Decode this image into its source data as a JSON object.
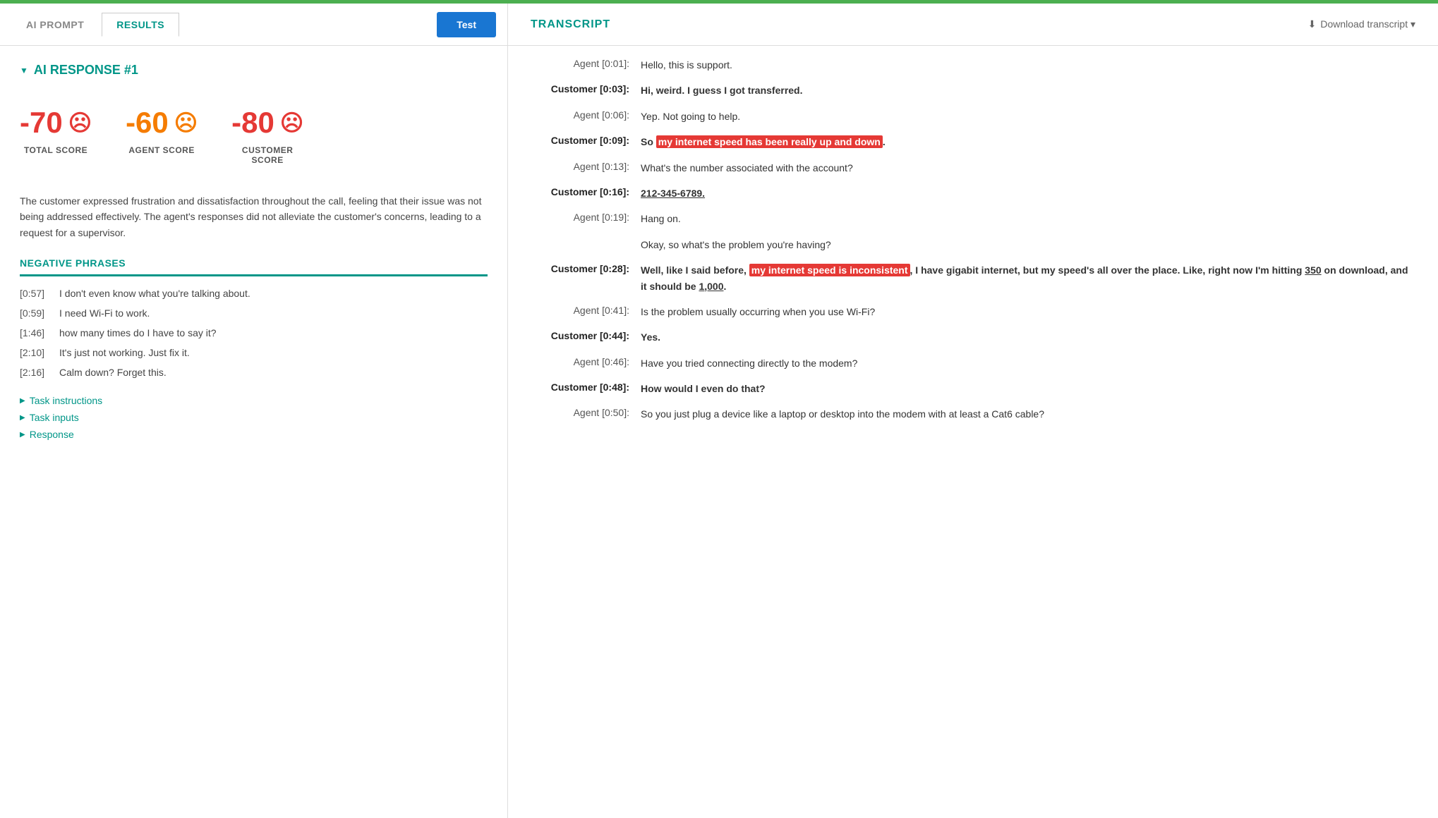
{
  "topbar": {
    "color": "#4caf50"
  },
  "tabs": {
    "ai_prompt_label": "AI PROMPT",
    "results_label": "RESULTS",
    "test_button_label": "Test"
  },
  "ai_response": {
    "header": "AI RESPONSE #1",
    "scores": [
      {
        "value": "-70",
        "label": "TOTAL SCORE",
        "color": "red"
      },
      {
        "value": "-60",
        "label": "AGENT SCORE",
        "color": "orange"
      },
      {
        "value": "-80",
        "label": "CUSTOMER\nSCORE",
        "color": "red"
      }
    ],
    "summary": "The customer expressed frustration and dissatisfaction throughout the call, feeling that their issue was not being addressed effectively. The agent's responses did not alleviate the customer's concerns, leading to a request for a supervisor.",
    "negative_phrases_title": "NEGATIVE PHRASES",
    "phrases": [
      {
        "time": "[0:57]",
        "text": "I don't even know what you're talking about."
      },
      {
        "time": "[0:59]",
        "text": "I need Wi-Fi to work."
      },
      {
        "time": "[1:46]",
        "text": "how many times do I have to say it?"
      },
      {
        "time": "[2:10]",
        "text": "It's just not working. Just fix it."
      },
      {
        "time": "[2:16]",
        "text": "Calm down? Forget this."
      }
    ],
    "bottom_links": [
      {
        "label": "Task instructions"
      },
      {
        "label": "Task inputs"
      },
      {
        "label": "Response"
      }
    ]
  },
  "transcript": {
    "title": "TRANSCRIPT",
    "download_label": "Download transcript ▾",
    "messages": [
      {
        "speaker": "Agent [0:01]:",
        "is_customer": false,
        "text_parts": [
          {
            "text": "Hello, this is support.",
            "highlight": false,
            "bold": false,
            "underline": false
          }
        ]
      },
      {
        "speaker": "Customer [0:03]:",
        "is_customer": true,
        "text_parts": [
          {
            "text": "Hi, weird. I guess I got transferred.",
            "highlight": false,
            "bold": true,
            "underline": false
          }
        ]
      },
      {
        "speaker": "Agent [0:06]:",
        "is_customer": false,
        "text_parts": [
          {
            "text": "Yep. Not going to help.",
            "highlight": false,
            "bold": false,
            "underline": false
          }
        ]
      },
      {
        "speaker": "Customer [0:09]:",
        "is_customer": true,
        "text_parts": [
          {
            "text": "So ",
            "highlight": false,
            "bold": true,
            "underline": false
          },
          {
            "text": "my internet speed has been really up and down",
            "highlight": true,
            "bold": true,
            "underline": false
          },
          {
            "text": ".",
            "highlight": false,
            "bold": true,
            "underline": false
          }
        ]
      },
      {
        "speaker": "Agent [0:13]:",
        "is_customer": false,
        "text_parts": [
          {
            "text": "What's the number associated with the account?",
            "highlight": false,
            "bold": false,
            "underline": false
          }
        ]
      },
      {
        "speaker": "Customer [0:16]:",
        "is_customer": true,
        "text_parts": [
          {
            "text": "212-345-6789.",
            "highlight": false,
            "bold": true,
            "underline": true
          }
        ]
      },
      {
        "speaker": "Agent [0:19]:",
        "is_customer": false,
        "text_parts": [
          {
            "text": "Hang on.",
            "highlight": false,
            "bold": false,
            "underline": false
          }
        ]
      },
      {
        "speaker": "",
        "is_customer": false,
        "text_parts": [
          {
            "text": "Okay, so what's the problem you're having?",
            "highlight": false,
            "bold": false,
            "underline": false
          }
        ]
      },
      {
        "speaker": "Customer [0:28]:",
        "is_customer": true,
        "text_parts": [
          {
            "text": "Well, like I said before, ",
            "highlight": false,
            "bold": true,
            "underline": false
          },
          {
            "text": "my internet speed is inconsistent",
            "highlight": true,
            "bold": true,
            "underline": false
          },
          {
            "text": ", I have gigabit internet, but my speed's all over the place. Like, right now I'm hitting ",
            "highlight": false,
            "bold": true,
            "underline": false
          },
          {
            "text": "350",
            "highlight": false,
            "bold": true,
            "underline": true
          },
          {
            "text": " on download, and it should be ",
            "highlight": false,
            "bold": true,
            "underline": false
          },
          {
            "text": "1,000",
            "highlight": false,
            "bold": true,
            "underline": true
          },
          {
            "text": ".",
            "highlight": false,
            "bold": true,
            "underline": false
          }
        ]
      },
      {
        "speaker": "Agent [0:41]:",
        "is_customer": false,
        "text_parts": [
          {
            "text": "Is the problem usually occurring when you use Wi-Fi?",
            "highlight": false,
            "bold": false,
            "underline": false
          }
        ]
      },
      {
        "speaker": "Customer [0:44]:",
        "is_customer": true,
        "text_parts": [
          {
            "text": "Yes.",
            "highlight": false,
            "bold": true,
            "underline": false
          }
        ]
      },
      {
        "speaker": "Agent [0:46]:",
        "is_customer": false,
        "text_parts": [
          {
            "text": "Have you tried connecting directly to the modem?",
            "highlight": false,
            "bold": false,
            "underline": false
          }
        ]
      },
      {
        "speaker": "Customer [0:48]:",
        "is_customer": true,
        "text_parts": [
          {
            "text": "How would I even do that?",
            "highlight": false,
            "bold": true,
            "underline": false
          }
        ]
      },
      {
        "speaker": "Agent [0:50]:",
        "is_customer": false,
        "text_parts": [
          {
            "text": "So you just plug a device like a laptop or desktop into the modem with at least a Cat6 cable?",
            "highlight": false,
            "bold": false,
            "underline": false
          }
        ]
      }
    ]
  }
}
